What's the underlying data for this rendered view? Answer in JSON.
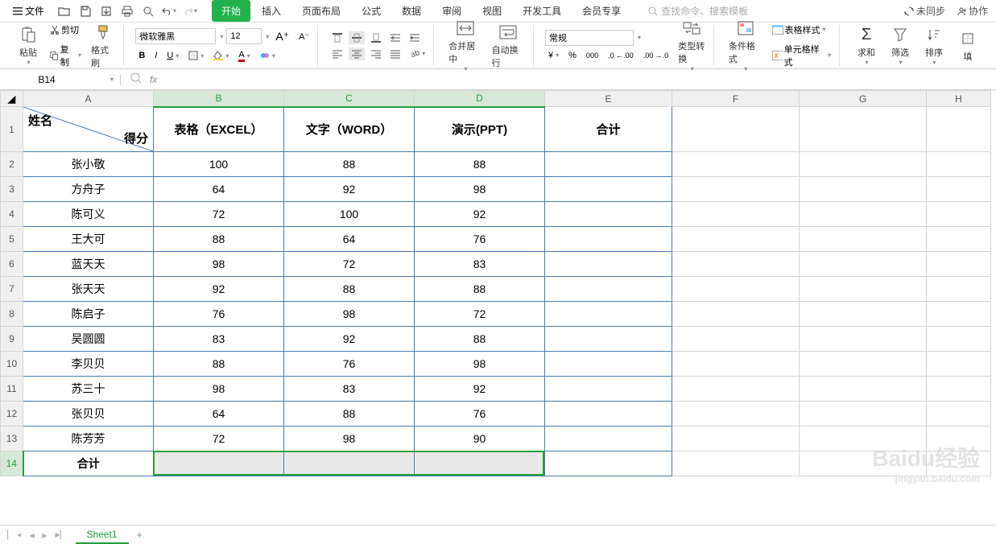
{
  "menu": {
    "file": "文件",
    "tabs": [
      "开始",
      "插入",
      "页面布局",
      "公式",
      "数据",
      "审阅",
      "视图",
      "开发工具",
      "会员专享"
    ],
    "active_tab_index": 0,
    "search_placeholder": "查找命令、搜索模板",
    "sync": "未同步",
    "collab": "协作"
  },
  "ribbon": {
    "paste": "粘贴",
    "cut": "剪切",
    "copy": "复制",
    "format_painter": "格式刷",
    "font_name": "微软雅黑",
    "font_size": "12",
    "merge": "合并居中",
    "wrap": "自动换行",
    "number_format": "常规",
    "type_convert": "类型转换",
    "cond_format": "条件格式",
    "table_style": "表格样式",
    "cell_style": "单元格样式",
    "sum": "求和",
    "filter": "筛选",
    "sort": "排序",
    "fill": "填"
  },
  "namebox": "B14",
  "columns": [
    "A",
    "B",
    "C",
    "D",
    "E",
    "F",
    "G",
    "H"
  ],
  "rows_visible": 14,
  "selected_cols": [
    "B",
    "C",
    "D"
  ],
  "selected_row": 14,
  "chart_data": {
    "type": "table",
    "corner": {
      "top_left": "姓名",
      "bottom_right": "得分"
    },
    "headers": [
      "表格（EXCEL）",
      "文字（WORD）",
      "演示(PPT)",
      "合计"
    ],
    "rows": [
      {
        "name": "张小敬",
        "values": [
          100,
          88,
          88
        ]
      },
      {
        "name": "方舟子",
        "values": [
          64,
          92,
          98
        ]
      },
      {
        "name": "陈可义",
        "values": [
          72,
          100,
          92
        ]
      },
      {
        "name": "王大可",
        "values": [
          88,
          64,
          76
        ]
      },
      {
        "name": "蓝天天",
        "values": [
          98,
          72,
          83
        ]
      },
      {
        "name": "张天天",
        "values": [
          92,
          88,
          88
        ]
      },
      {
        "name": "陈启子",
        "values": [
          76,
          98,
          72
        ]
      },
      {
        "name": "吴圆圆",
        "values": [
          83,
          92,
          88
        ]
      },
      {
        "name": "李贝贝",
        "values": [
          88,
          76,
          98
        ]
      },
      {
        "name": "苏三十",
        "values": [
          98,
          83,
          92
        ]
      },
      {
        "name": "张贝贝",
        "values": [
          64,
          88,
          76
        ]
      },
      {
        "name": "陈芳芳",
        "values": [
          72,
          98,
          90
        ]
      }
    ],
    "footer_label": "合计"
  },
  "sheet": {
    "name": "Sheet1"
  },
  "watermark": {
    "brand": "Baidu经验",
    "sub": "jingyan.baidu.com"
  }
}
